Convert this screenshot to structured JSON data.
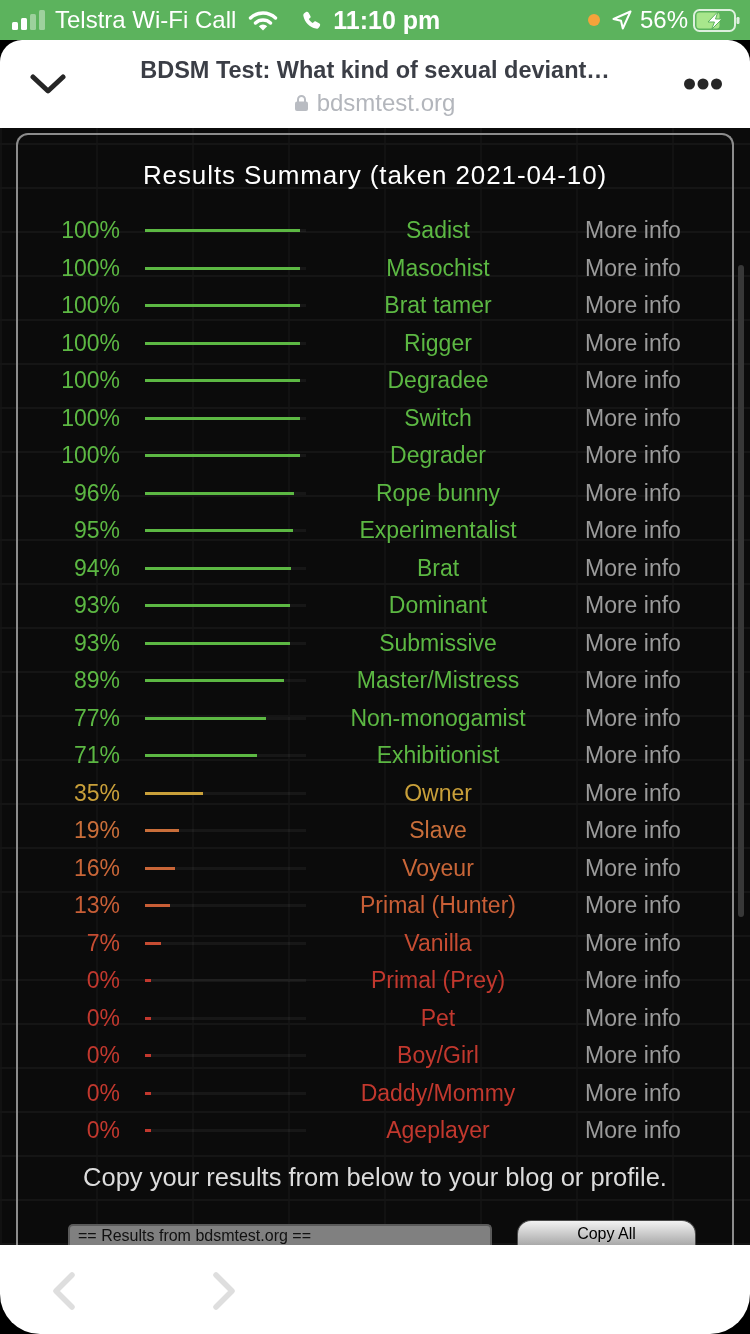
{
  "status_bar": {
    "carrier": "Telstra Wi-Fi Call",
    "time": "11:10 pm",
    "battery": "56%"
  },
  "browser_header": {
    "title": "BDSM Test: What kind of sexual deviant…",
    "url": "bdsmtest.org"
  },
  "results": {
    "title": "Results Summary (taken 2021-04-10)",
    "rows": [
      {
        "percent": "100%",
        "level": 1,
        "name": "Sadist",
        "link": "More info",
        "color": "#5cb843"
      },
      {
        "percent": "100%",
        "level": 1,
        "name": "Masochist",
        "link": "More info",
        "color": "#5cb843"
      },
      {
        "percent": "100%",
        "level": 1,
        "name": "Brat tamer",
        "link": "More info",
        "color": "#5cb843"
      },
      {
        "percent": "100%",
        "level": 1,
        "name": "Rigger",
        "link": "More info",
        "color": "#5cb843"
      },
      {
        "percent": "100%",
        "level": 1,
        "name": "Degradee",
        "link": "More info",
        "color": "#5cb843"
      },
      {
        "percent": "100%",
        "level": 1,
        "name": "Switch",
        "link": "More info",
        "color": "#5cb843"
      },
      {
        "percent": "100%",
        "level": 1,
        "name": "Degrader",
        "link": "More info",
        "color": "#5cb843"
      },
      {
        "percent": "96%",
        "level": 0.96,
        "name": "Rope bunny",
        "link": "More info",
        "color": "#5cb843"
      },
      {
        "percent": "95%",
        "level": 0.95,
        "name": "Experimentalist",
        "link": "More info",
        "color": "#5cb843"
      },
      {
        "percent": "94%",
        "level": 0.94,
        "name": "Brat",
        "link": "More info",
        "color": "#5cb843"
      },
      {
        "percent": "93%",
        "level": 0.93,
        "name": "Dominant",
        "link": "More info",
        "color": "#5cb843"
      },
      {
        "percent": "93%",
        "level": 0.93,
        "name": "Submissive",
        "link": "More info",
        "color": "#5cb843"
      },
      {
        "percent": "89%",
        "level": 0.89,
        "name": "Master/Mistress",
        "link": "More info",
        "color": "#5cb843"
      },
      {
        "percent": "77%",
        "level": 0.77,
        "name": "Non-monogamist",
        "link": "More info",
        "color": "#5cb843"
      },
      {
        "percent": "71%",
        "level": 0.71,
        "name": "Exhibitionist",
        "link": "More info",
        "color": "#5cb843"
      },
      {
        "percent": "35%",
        "level": 0.35,
        "name": "Owner",
        "link": "More info",
        "color": "#c9a03a"
      },
      {
        "percent": "19%",
        "level": 0.19,
        "name": "Slave",
        "link": "More info",
        "color": "#c96e3a"
      },
      {
        "percent": "16%",
        "level": 0.16,
        "name": "Voyeur",
        "link": "More info",
        "color": "#c96638"
      },
      {
        "percent": "13%",
        "level": 0.13,
        "name": "Primal (Hunter)",
        "link": "More info",
        "color": "#c85e36"
      },
      {
        "percent": "7%",
        "level": 0.07,
        "name": "Vanilla",
        "link": "More info",
        "color": "#c64c32"
      },
      {
        "percent": "0%",
        "level": 0,
        "name": "Primal (Prey)",
        "link": "More info",
        "color": "#c2382e"
      },
      {
        "percent": "0%",
        "level": 0,
        "name": "Pet",
        "link": "More info",
        "color": "#c2382e"
      },
      {
        "percent": "0%",
        "level": 0,
        "name": "Boy/Girl",
        "link": "More info",
        "color": "#c2382e"
      },
      {
        "percent": "0%",
        "level": 0,
        "name": "Daddy/Mommy",
        "link": "More info",
        "color": "#c2382e"
      },
      {
        "percent": "0%",
        "level": 0,
        "name": "Ageplayer",
        "link": "More info",
        "color": "#c2382e"
      }
    ],
    "copy_note": "Copy your results from below to your blog or profile.",
    "results_box": {
      "value": "== Results from bdsmtest.org =="
    },
    "copy_button": "Copy All"
  },
  "toolbar": [
    {
      "kind": "back",
      "disabled": true
    },
    {
      "kind": "forward",
      "disabled": true
    }
  ]
}
